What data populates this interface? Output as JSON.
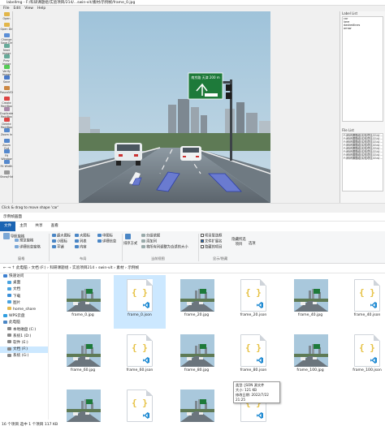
{
  "labelimg": {
    "title": "labelImg - F:/科研课题组/实验项目/214/...swin-vit/素材/示例帧/frame_0.jpg",
    "menu": [
      "File",
      "Edit",
      "View",
      "Help"
    ],
    "tools": [
      {
        "label": "Open",
        "icon": "folder-icon"
      },
      {
        "label": "Open Dir",
        "icon": "folder-open-icon"
      },
      {
        "label": "Change Save Dir",
        "icon": "folder-save-icon"
      },
      {
        "label": "Next Image",
        "icon": "next-icon"
      },
      {
        "label": "Prev Image",
        "icon": "prev-icon"
      },
      {
        "label": "Verify Image",
        "icon": "verify-icon"
      },
      {
        "label": "Save",
        "icon": "save-icon"
      },
      {
        "label": "PascalVOC",
        "icon": "format-icon"
      },
      {
        "label": "Create RectBox",
        "icon": "rect-icon"
      },
      {
        "label": "Duplicate RectBox",
        "icon": "copy-icon"
      },
      {
        "label": "Delete RectBox",
        "icon": "delete-icon"
      },
      {
        "label": "Zoom In",
        "icon": "zoom-in-icon"
      },
      {
        "label": "Zoom Out",
        "icon": "zoom-out-icon"
      },
      {
        "label": "Fit Window",
        "icon": "fit-icon"
      },
      {
        "label": "Fit Width",
        "icon": "fit-width-icon"
      },
      {
        "label": "Show/Hide",
        "icon": "eye-icon"
      }
    ],
    "label_list_title": "Label List",
    "labels": [
      "car",
      "lane",
      "dashedlines",
      "arrow"
    ],
    "file_list_title": "File List",
    "files": [
      "F:/科研课题组/实验项目/214/...",
      "F:/科研课题组/实验项目/214/...",
      "F:/科研课题组/实验项目/214/...",
      "F:/科研课题组/实验项目/214/...",
      "F:/科研课题组/实验项目/214/...",
      "F:/科研课题组/实验项目/214/...",
      "F:/科研课题组/实验项目/214/...",
      "F:/科研课题组/实验项目/214/..."
    ],
    "status": "Click & drag to move shape 'car'",
    "sign_text": "南京路   天津  200 m"
  },
  "explorer": {
    "title": "示例帧画面",
    "tabs": [
      "文件",
      "主页",
      "共享",
      "查看"
    ],
    "ribbon": {
      "pane_group": "窗格",
      "layout_group": "布局",
      "view_group": "当前视图",
      "showhide_group": "显示/隐藏",
      "layout_items": [
        "超大图标",
        "大图标",
        "中图标",
        "小图标",
        "列表",
        "详细信息",
        "平铺",
        "内容"
      ],
      "view_items": [
        "分组依据",
        "添加列",
        "将所有列调整为合适的大小"
      ],
      "sort_label": "排序方式",
      "showhide_items": [
        "项目复选框",
        "文件扩展名",
        "隐藏的项目"
      ],
      "hide_selected": "隐藏所选项目",
      "options": "选项",
      "nav_pane": "导航窗格",
      "preview_pane": "预览窗格",
      "details_pane": "详细信息窗格"
    },
    "address": "此电脑 › 文档 (F:) › 科研课题组 › 实验项目214 › swin-vit › 素材 › 示例帧",
    "search_placeholder": "在 示例帧 中搜索",
    "nav": [
      "快速访问",
      "桌面",
      "文档",
      "下载",
      "图片",
      "home_share",
      "WPS云盘",
      "此电脑",
      "本地磁盘 (C:)",
      "系统1 (D:)",
      "软件 (E:)",
      "文档 (F:)",
      "系统 (G:)"
    ],
    "files": [
      {
        "name": "frame_0.jpg",
        "type": "jpg"
      },
      {
        "name": "frame_0.json",
        "type": "json",
        "selected": true
      },
      {
        "name": "frame_20.jpg",
        "type": "jpg"
      },
      {
        "name": "frame_20.json",
        "type": "json"
      },
      {
        "name": "frame_40.jpg",
        "type": "jpg"
      },
      {
        "name": "frame_40.json",
        "type": "json"
      },
      {
        "name": "frame_60.jpg",
        "type": "jpg"
      },
      {
        "name": "frame_60.json",
        "type": "json"
      },
      {
        "name": "frame_80.jpg",
        "type": "jpg"
      },
      {
        "name": "frame_80.json",
        "type": "json"
      },
      {
        "name": "frame_100.jpg",
        "type": "jpg"
      },
      {
        "name": "frame_100.json",
        "type": "json"
      },
      {
        "name": "",
        "type": "jpg"
      },
      {
        "name": "",
        "type": "json"
      },
      {
        "name": "",
        "type": "jpg"
      },
      {
        "name": "",
        "type": "json"
      }
    ],
    "tooltip": [
      "类型: JSON 源文件",
      "大小: 121 KB",
      "修改日期: 2022/7/22 21:25"
    ],
    "status": "16 个项目    选中 1 个项目  117 KB"
  },
  "colors": {
    "accent": "#1b64b3",
    "selection": "#cce8ff",
    "sign": "#1e7a3a"
  }
}
